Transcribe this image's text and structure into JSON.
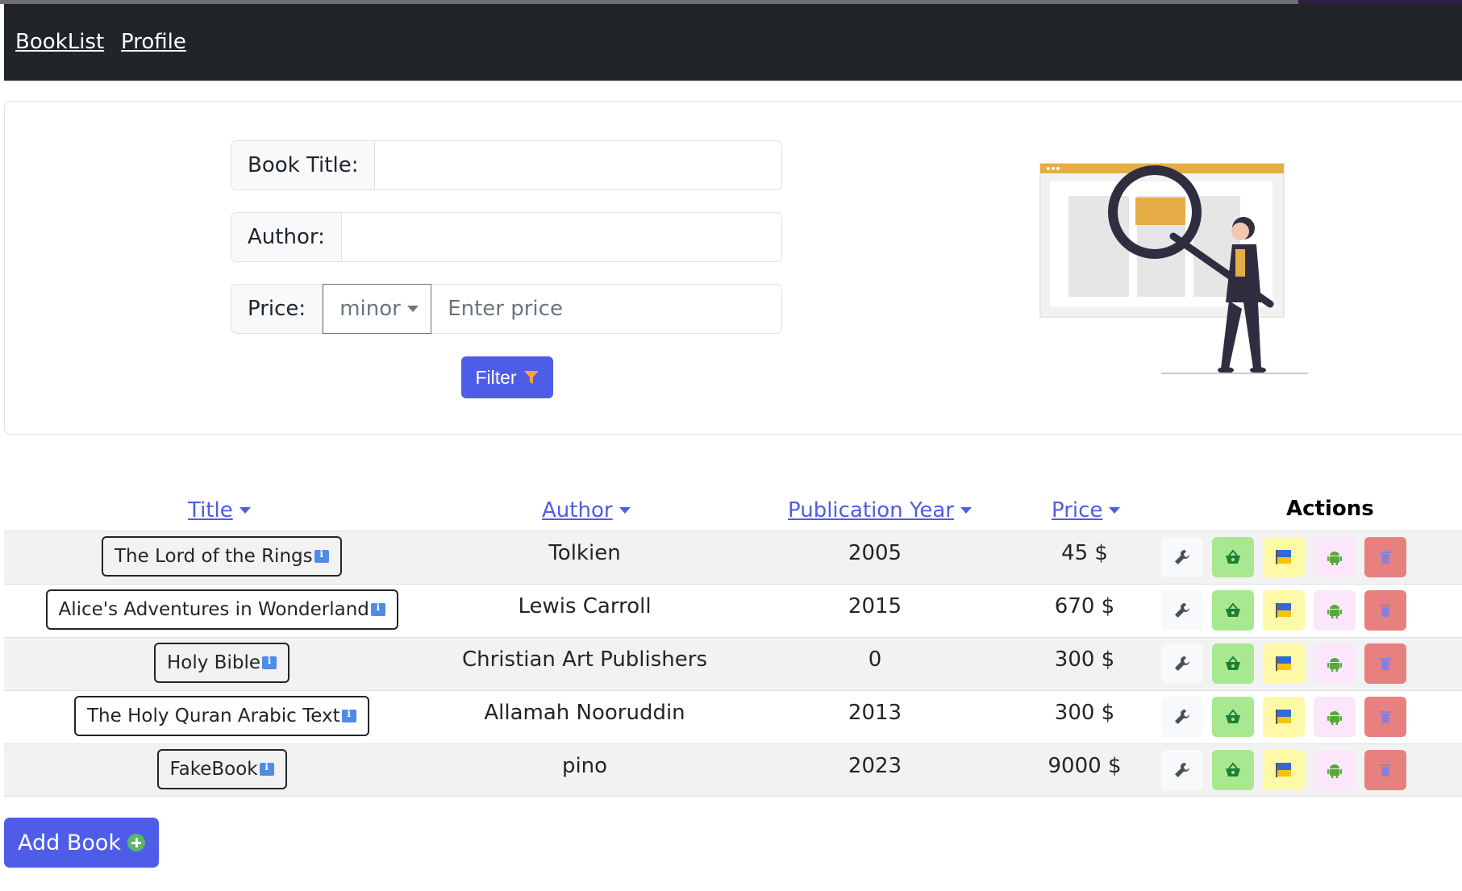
{
  "nav": {
    "booklist": "BookList",
    "profile": "Profile"
  },
  "filter": {
    "title_label": "Book Title:",
    "author_label": "Author:",
    "price_label": "Price:",
    "price_operator": "minor",
    "price_placeholder": "Enter price",
    "button_label": "Filter"
  },
  "table": {
    "headers": {
      "title": "Title",
      "author": "Author",
      "year": "Publication Year",
      "price": "Price",
      "actions": "Actions"
    },
    "rows": [
      {
        "title": "The Lord of the Rings",
        "author": "Tolkien",
        "year": "2005",
        "price": "45 $"
      },
      {
        "title": "Alice's Adventures in Wonderland",
        "author": "Lewis Carroll",
        "year": "2015",
        "price": "670 $"
      },
      {
        "title": "Holy Bible",
        "author": "Christian Art Publishers",
        "year": "0",
        "price": "300 $"
      },
      {
        "title": "The Holy Quran Arabic Text",
        "author": "Allamah Nooruddin",
        "year": "2013",
        "price": "300 $"
      },
      {
        "title": "FakeBook",
        "author": "pino",
        "year": "2023",
        "price": "9000 $"
      }
    ]
  },
  "add_button": "Add Book",
  "colors": {
    "primary": "#4e5de8",
    "navbar": "#212529",
    "buy": "#a8e890",
    "flag": "#fdf9a6",
    "android": "#fbe6fb",
    "delete": "#e88080",
    "illustration_accent": "#e6ac45"
  },
  "icons": {
    "edit": "wrench-icon",
    "buy": "basket-icon",
    "flag": "ukraine-flag-icon",
    "android": "android-icon",
    "delete": "trash-icon",
    "info": "info-icon",
    "filter": "funnel-icon",
    "add": "plus-circle-icon"
  }
}
